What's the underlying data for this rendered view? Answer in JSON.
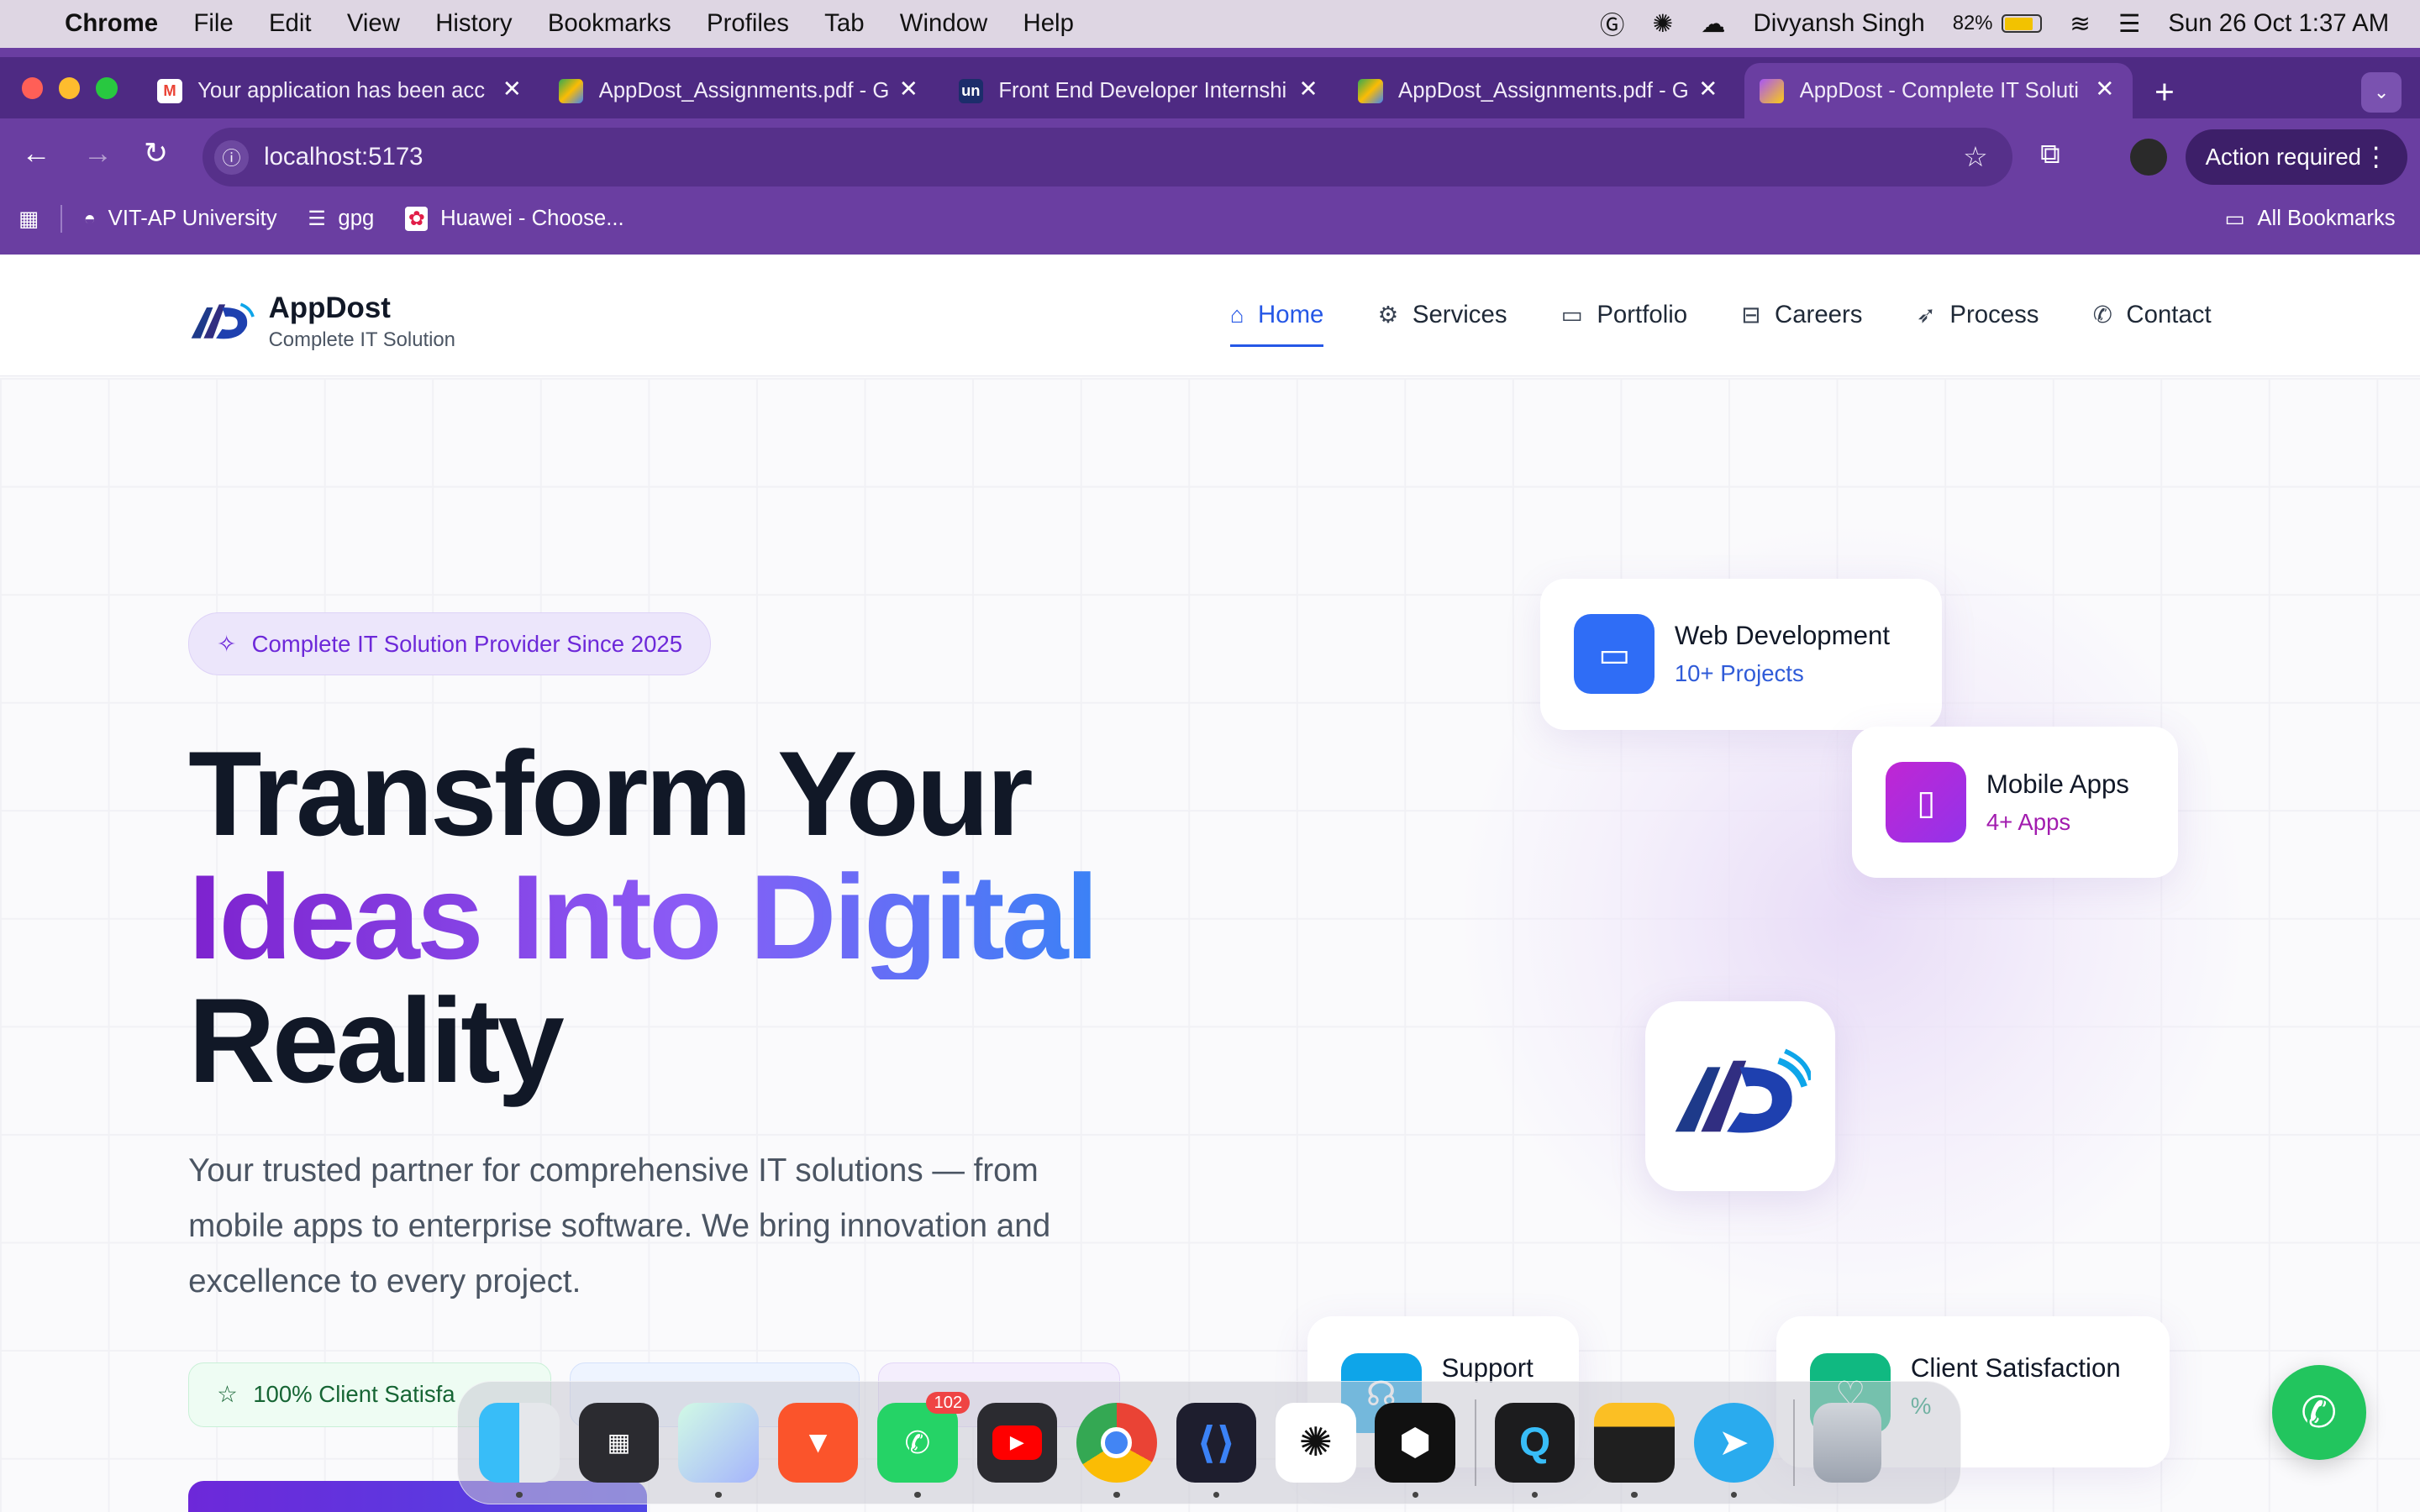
{
  "menubar": {
    "app": "Chrome",
    "items": [
      "File",
      "Edit",
      "View",
      "History",
      "Bookmarks",
      "Profiles",
      "Tab",
      "Window",
      "Help"
    ],
    "user": "Divyansh Singh",
    "battery": "82%",
    "datetime": "Sun 26 Oct  1:37 AM"
  },
  "tabs": [
    {
      "title": "Your application has been acc",
      "icon": "gmail-icon"
    },
    {
      "title": "AppDost_Assignments.pdf - G",
      "icon": "drive-icon"
    },
    {
      "title": "Front End Developer Internshi",
      "icon": "unstop-icon",
      "icon_text": "un"
    },
    {
      "title": "AppDost_Assignments.pdf - G",
      "icon": "drive-icon"
    },
    {
      "title": "AppDost - Complete IT Soluti",
      "icon": "vite-icon",
      "active": true
    }
  ],
  "omnibox": {
    "url": "localhost:5173"
  },
  "profile": {
    "action": "Action required"
  },
  "bookmarks": {
    "items": [
      {
        "label": "VIT-AP University"
      },
      {
        "label": "gpg"
      },
      {
        "label": "Huawei - Choose..."
      }
    ],
    "all": "All Bookmarks"
  },
  "site": {
    "brand": {
      "name": "AppDost",
      "tagline": "Complete IT Solution"
    },
    "nav": [
      {
        "label": "Home",
        "icon": "home-icon",
        "active": true
      },
      {
        "label": "Services",
        "icon": "gear-icon"
      },
      {
        "label": "Portfolio",
        "icon": "folder-icon"
      },
      {
        "label": "Careers",
        "icon": "briefcase-icon"
      },
      {
        "label": "Process",
        "icon": "rocket-icon"
      },
      {
        "label": "Contact",
        "icon": "phone-icon"
      }
    ],
    "hero": {
      "badge": "Complete IT Solution Provider Since 2025",
      "title_line1": "Transform Your",
      "title_line2": "Ideas Into Digital",
      "title_line3": "Reality",
      "lead": "Your trusted partner for comprehensive IT solutions — from mobile apps to enterprise software. We bring innovation and excellence to every project.",
      "pill1": "100% Client Satisfa"
    },
    "cards": {
      "web": {
        "title": "Web Development",
        "sub": "10+ Projects",
        "color": "#2f6df6"
      },
      "mobile": {
        "title": "Mobile Apps",
        "sub": "4+ Apps",
        "color": "#a21caf"
      },
      "support": {
        "title": "Support"
      },
      "satisfaction": {
        "title": "Client Satisfaction",
        "sub": "%"
      }
    }
  },
  "dock": {
    "apps": [
      "finder",
      "launchpad",
      "affinity",
      "brave",
      "whatsapp",
      "youtube",
      "chrome",
      "vscode",
      "chatgpt",
      "cursor",
      "quicktime",
      "notes",
      "telegram",
      "trash"
    ],
    "whatsapp_badge": "102"
  }
}
